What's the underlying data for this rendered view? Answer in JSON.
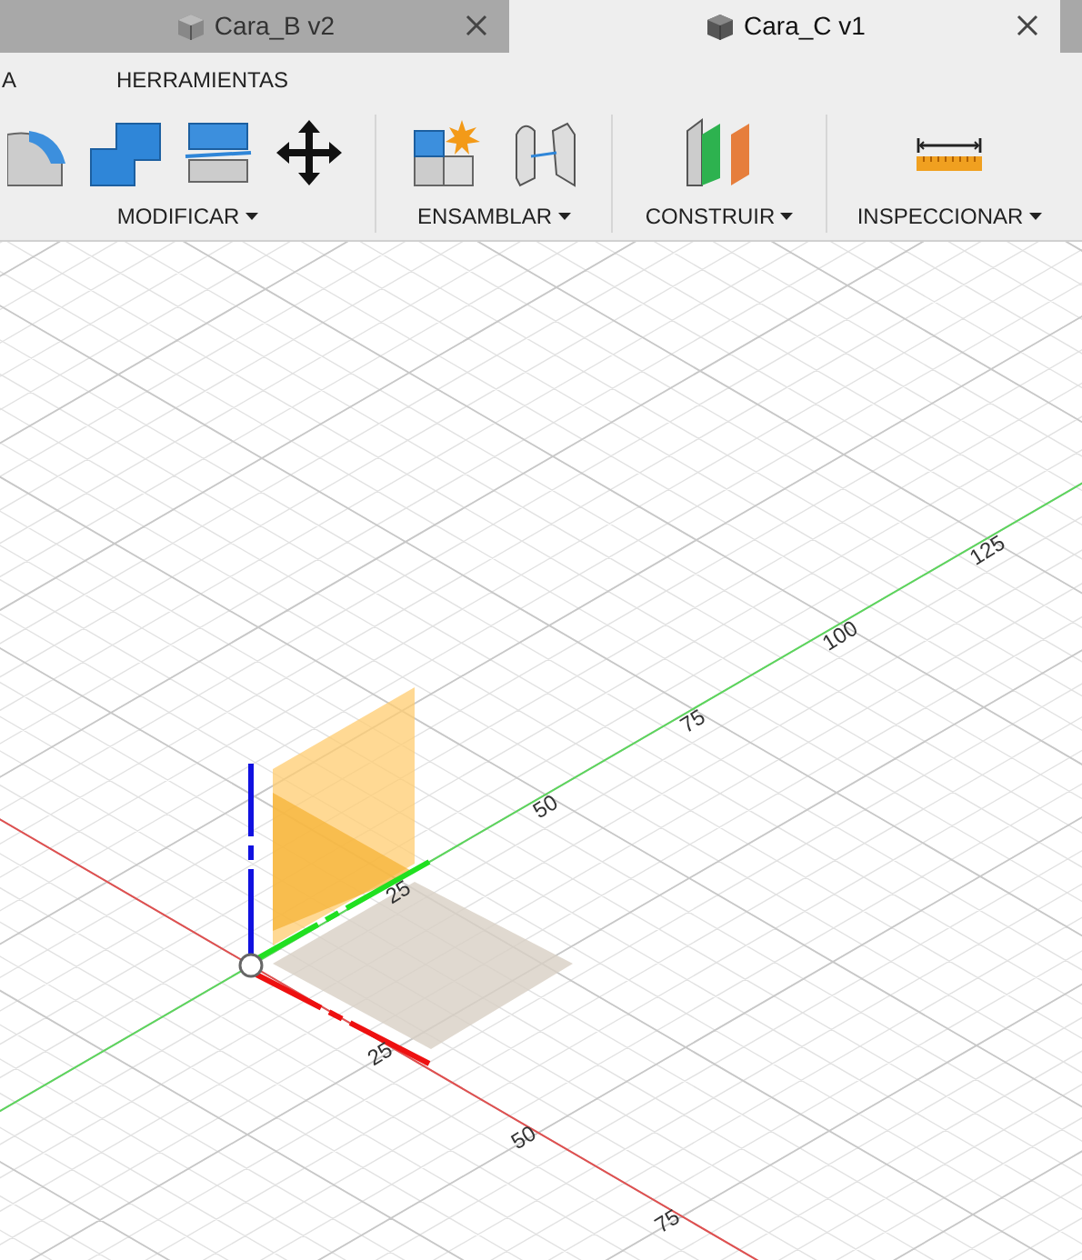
{
  "tabs": [
    {
      "label": "Cara_B v2",
      "selected": false
    },
    {
      "label": "Cara_C v1",
      "selected": true
    }
  ],
  "menu": [
    "A",
    "HERRAMIENTAS"
  ],
  "toolbar_groups": [
    {
      "label": "MODIFICAR"
    },
    {
      "label": "ENSAMBLAR"
    },
    {
      "label": "CONSTRUIR"
    },
    {
      "label": "INSPECCIONAR"
    }
  ],
  "viewport": {
    "green_axis_labels": [
      "25",
      "50",
      "75",
      "100",
      "125"
    ],
    "red_axis_labels": [
      "25",
      "50",
      "75"
    ]
  }
}
